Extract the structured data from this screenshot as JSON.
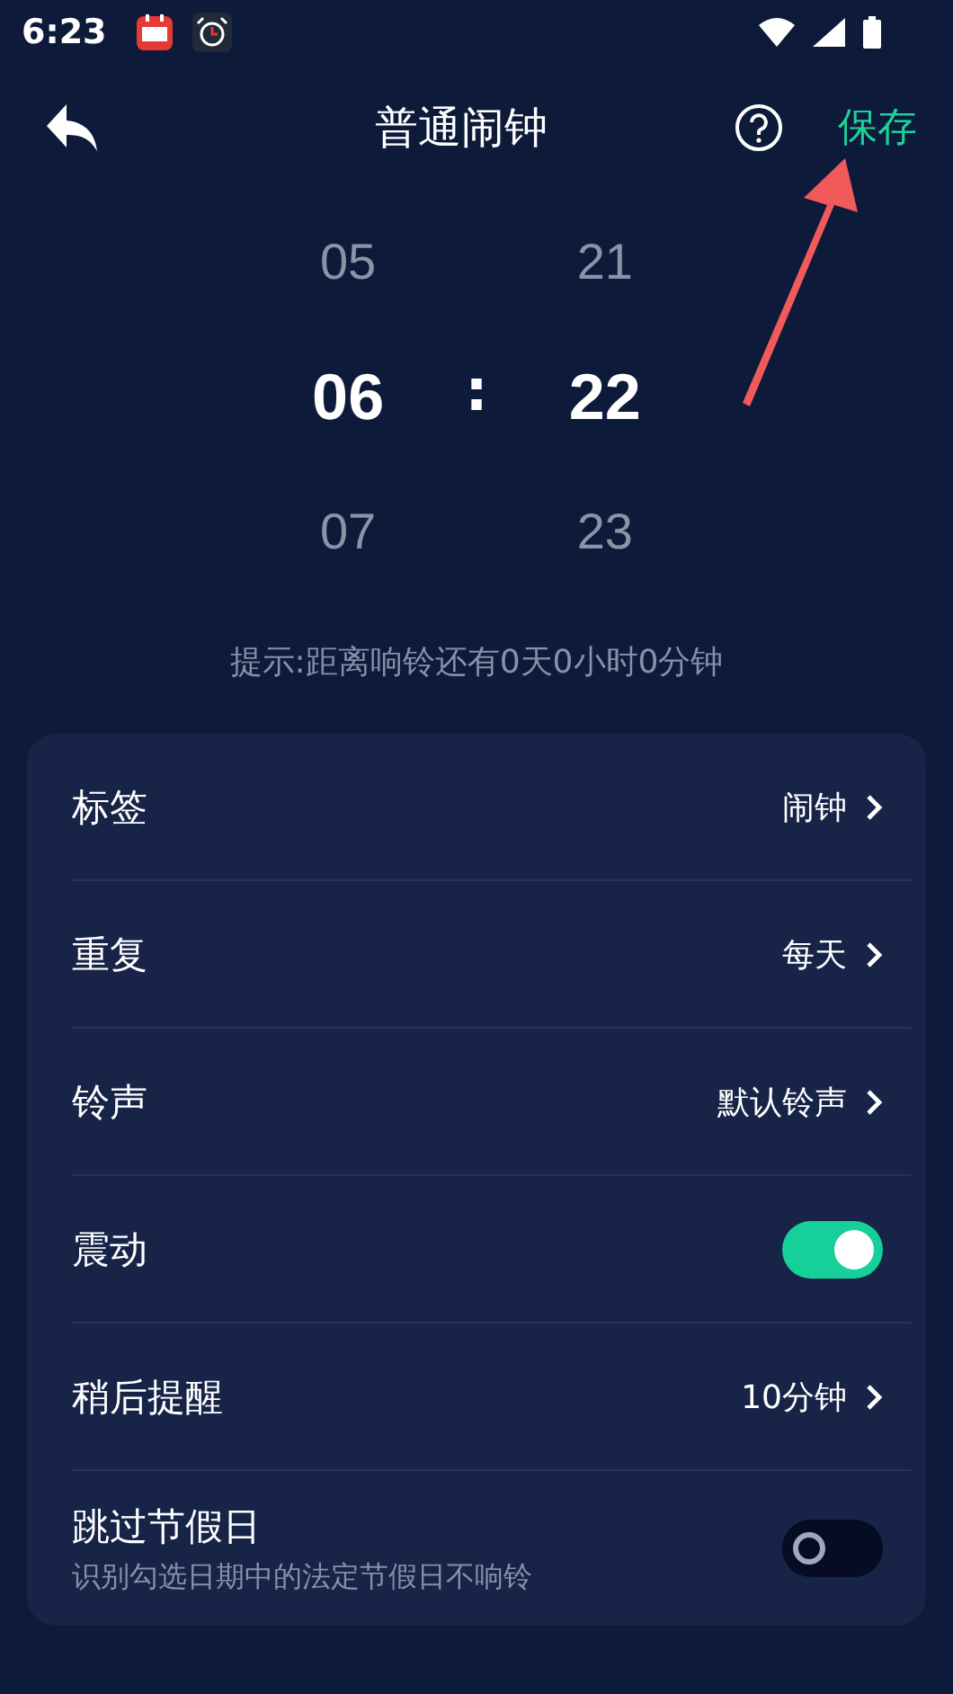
{
  "status_bar": {
    "time": "6:23"
  },
  "header": {
    "title": "普通闹钟",
    "action": "保存"
  },
  "picker": {
    "hours": [
      {
        "value": "05",
        "selected": false
      },
      {
        "value": "06",
        "selected": true
      },
      {
        "value": "07",
        "selected": false
      }
    ],
    "separator": ":",
    "minutes": [
      {
        "value": "21",
        "selected": false
      },
      {
        "value": "22",
        "selected": true
      },
      {
        "value": "23",
        "selected": false
      }
    ]
  },
  "hint": "提示:距离响铃还有0天0小时0分钟",
  "settings": [
    {
      "kind": "link",
      "label": "标签",
      "value": "闹钟"
    },
    {
      "kind": "link",
      "label": "重复",
      "value": "每天"
    },
    {
      "kind": "link",
      "label": "铃声",
      "value": "默认铃声"
    },
    {
      "kind": "switch",
      "label": "震动",
      "on": true
    },
    {
      "kind": "link",
      "label": "稍后提醒",
      "value": "10分钟"
    },
    {
      "kind": "switch",
      "label": "跳过节假日",
      "description": "识别勾选日期中的法定节假日不响铃",
      "on": false
    }
  ]
}
